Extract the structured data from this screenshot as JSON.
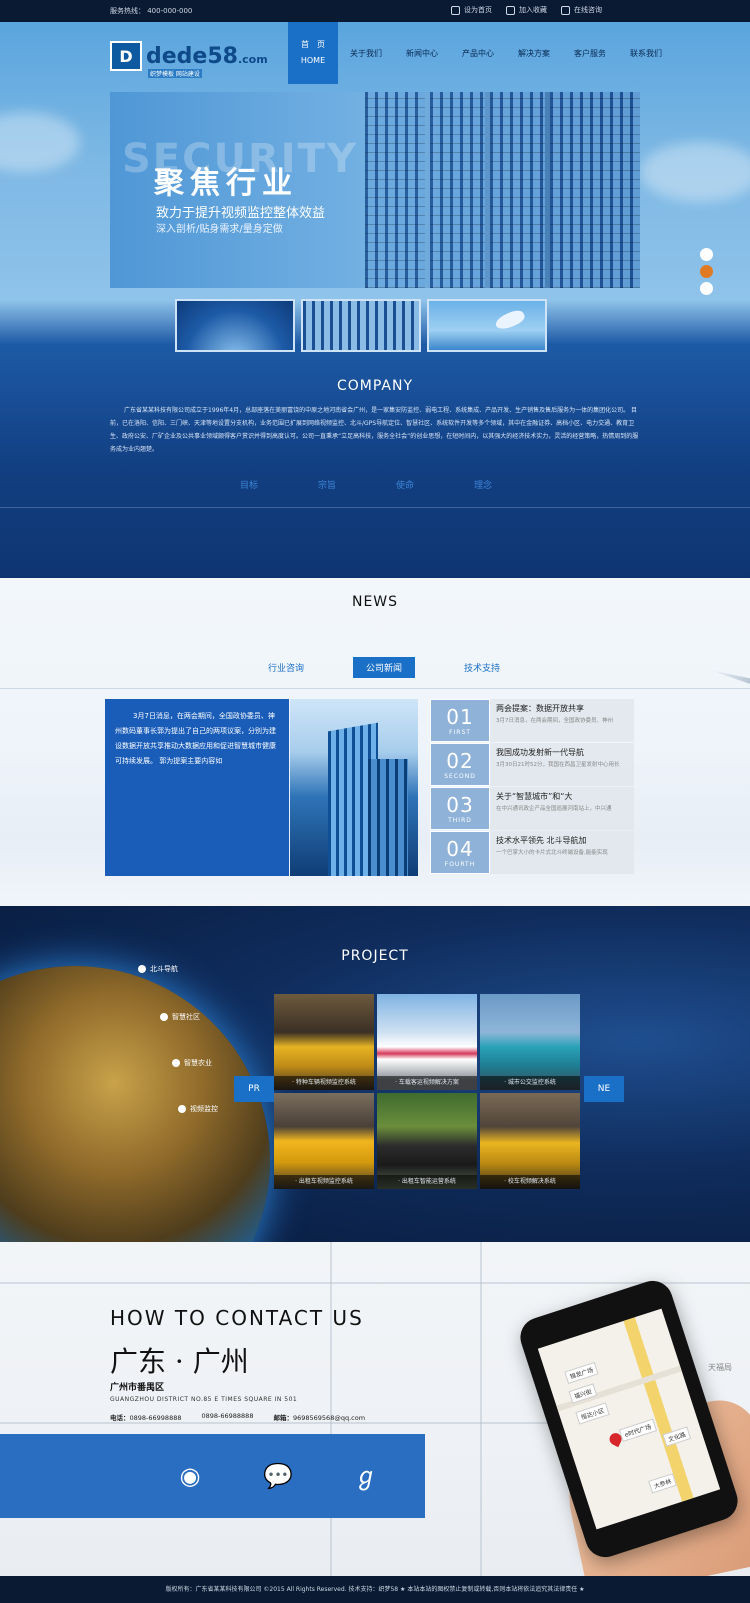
{
  "topbar": {
    "hotline": "服务热线： 400-000-000",
    "links": [
      "设为首页",
      "加入收藏",
      "在线咨询"
    ],
    "link_icons": [
      "home-icon",
      "expand-icon",
      "edit-icon"
    ]
  },
  "logo": {
    "text": "dede58",
    "suffix": ".com",
    "tagline": "织梦模板 网站建设"
  },
  "nav": {
    "home_cn": "首　页",
    "home_en": "HOME",
    "items": [
      "关于我们",
      "新闻中心",
      "产品中心",
      "解决方案",
      "客户服务",
      "联系我们"
    ]
  },
  "banner": {
    "ghost": "SECURITY",
    "headline": "聚焦行业",
    "subline": "致力于提升视频监控整体效益",
    "subline2": "深入剖析/贴身需求/量身定做"
  },
  "company": {
    "title": "COMPANY",
    "intro": "广东省某某科技有限公司成立于1996年4月，总部座落在美丽富饶的中原之地河南省会广州，是一家集安防监控、弱电工程、系统集成、产品开发、生产销售及售后服务为一体的集团化公司。 目前，已在洛阳、信阳、三门峡、天津等地设置分支机构，业务范围已扩展到网络视频监控、北斗/GPS导航定位、智慧社区、系统软件开发等多个领域，其中在金融证券、高档小区、电力交通、教育卫生、政府公安、厂矿企业及公共事业领域颇得客户赏识并得到高度认可。公司一直秉承“立足高科技，服务全社会”的创业思想，在短时间内，以其强大的经济技术实力，灵活的经营策略，热情周到的服务成为业内翘楚。",
    "values": [
      "目标",
      "宗旨",
      "使命",
      "理念"
    ]
  },
  "news": {
    "title": "NEWS",
    "tabs": [
      "行业咨询",
      "公司新闻",
      "技术支持"
    ],
    "active_tab": "公司新闻",
    "feature_text": "3月7日消息，在两会期间，全国政协委员、神州数码董事长郭为提出了自己的两项议案，分别为建设数据开放共享推动大数据应用和促进智慧城市健康可持续发展。 郭为提案主要内容如",
    "items": [
      {
        "num": "01",
        "word": "FIRST",
        "title": "两会提案：数据开放共享",
        "desc": "3月7日消息，在两会期间，全国政协委员、神州"
      },
      {
        "num": "02",
        "word": "SECOND",
        "title": "我国成功发射新一代导航",
        "desc": "3月30日21时52分，我国在西昌卫星发射中心用长"
      },
      {
        "num": "03",
        "word": "THIRD",
        "title": "关于“智慧城市”和“大",
        "desc": "在中兴通讯政企产品全国巡展河南站上，中兴通"
      },
      {
        "num": "04",
        "word": "FOURTH",
        "title": "技术水平领先 北斗导航加",
        "desc": "一个巴掌大小的卡片式北斗终端设备,能能实现"
      }
    ]
  },
  "project": {
    "title": "PROJECT",
    "pins": [
      "北斗导航",
      "智慧社区",
      "智慧农业",
      "视频监控"
    ],
    "prev": "PR",
    "next": "NE",
    "items": [
      "· 特种车辆视频监控系统",
      "· 车载客运视频解决方案",
      "· 城市公交监控系统",
      "· 出租车视频监控系统",
      "· 出租车智能运营系统",
      "· 校车视频解决系统"
    ]
  },
  "contact": {
    "how": "HOW  TO  CONTACT  US",
    "city": "广东 · 广州",
    "district": "广州市番禺区",
    "address_en": "GUANGZHOU DISTRICT NO.85 E TIMES SQUARE IN 501",
    "phone_label": "电话：",
    "phone1": "0898-66998888",
    "phone2": "0898-66988888",
    "email_label": "邮箱：",
    "email": "9698569568@qq.com",
    "social_icons": [
      "weibo-icon",
      "wechat-icon",
      "tencent-icon"
    ],
    "map_labels": [
      "锦发广场",
      "福兴街",
      "恒达小区",
      "e时代广场",
      "文化路",
      "大参林",
      "天福局"
    ]
  },
  "footer": {
    "text": "版权所有：广东省某某科技有限公司 ©2015 All Rights Reserved. 技术支持：织梦58 ★ 本站本站的图权禁止复制或转载,否则本站将依法追究其法律责任 ★"
  }
}
